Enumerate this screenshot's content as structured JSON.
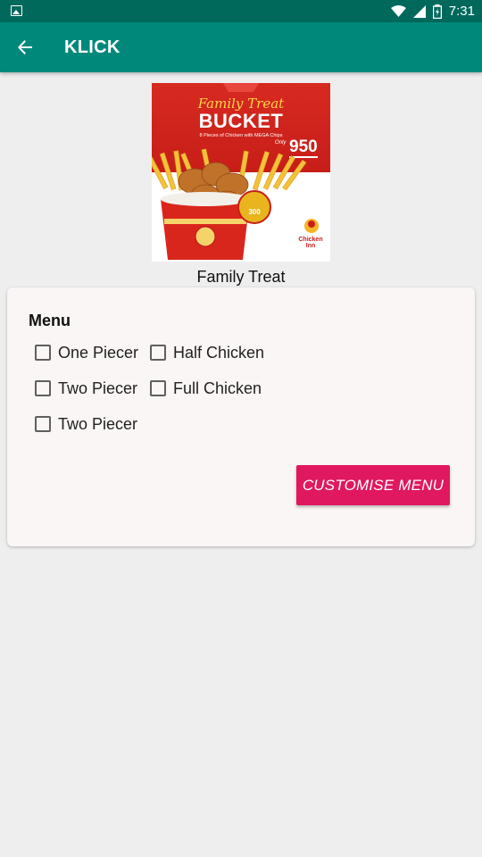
{
  "status_bar": {
    "time": "7:31",
    "icons": [
      "gallery-icon",
      "wifi-icon",
      "signal-icon",
      "battery-charging-icon"
    ]
  },
  "app_bar": {
    "title": "KLICK",
    "back_icon": "back-arrow-icon",
    "color": "#00897b"
  },
  "product": {
    "image": {
      "headline": "Family Treat",
      "title": "BUCKET",
      "subtitle": "8 Pieces of Chicken with MEGA Chips",
      "price_prefix": "Only",
      "price": "950",
      "drink_price": "300",
      "brand": "Chicken Inn"
    },
    "name": "Family Treat"
  },
  "menu_card": {
    "title": "Menu",
    "options": [
      {
        "label": "One Piecer",
        "checked": false
      },
      {
        "label": "Half Chicken",
        "checked": false
      },
      {
        "label": "Two Piecer",
        "checked": false
      },
      {
        "label": "Full Chicken",
        "checked": false
      },
      {
        "label": "Two Piecer",
        "checked": false
      }
    ],
    "button_label": "CUSTOMISE MENU",
    "button_color": "#e0185f"
  }
}
